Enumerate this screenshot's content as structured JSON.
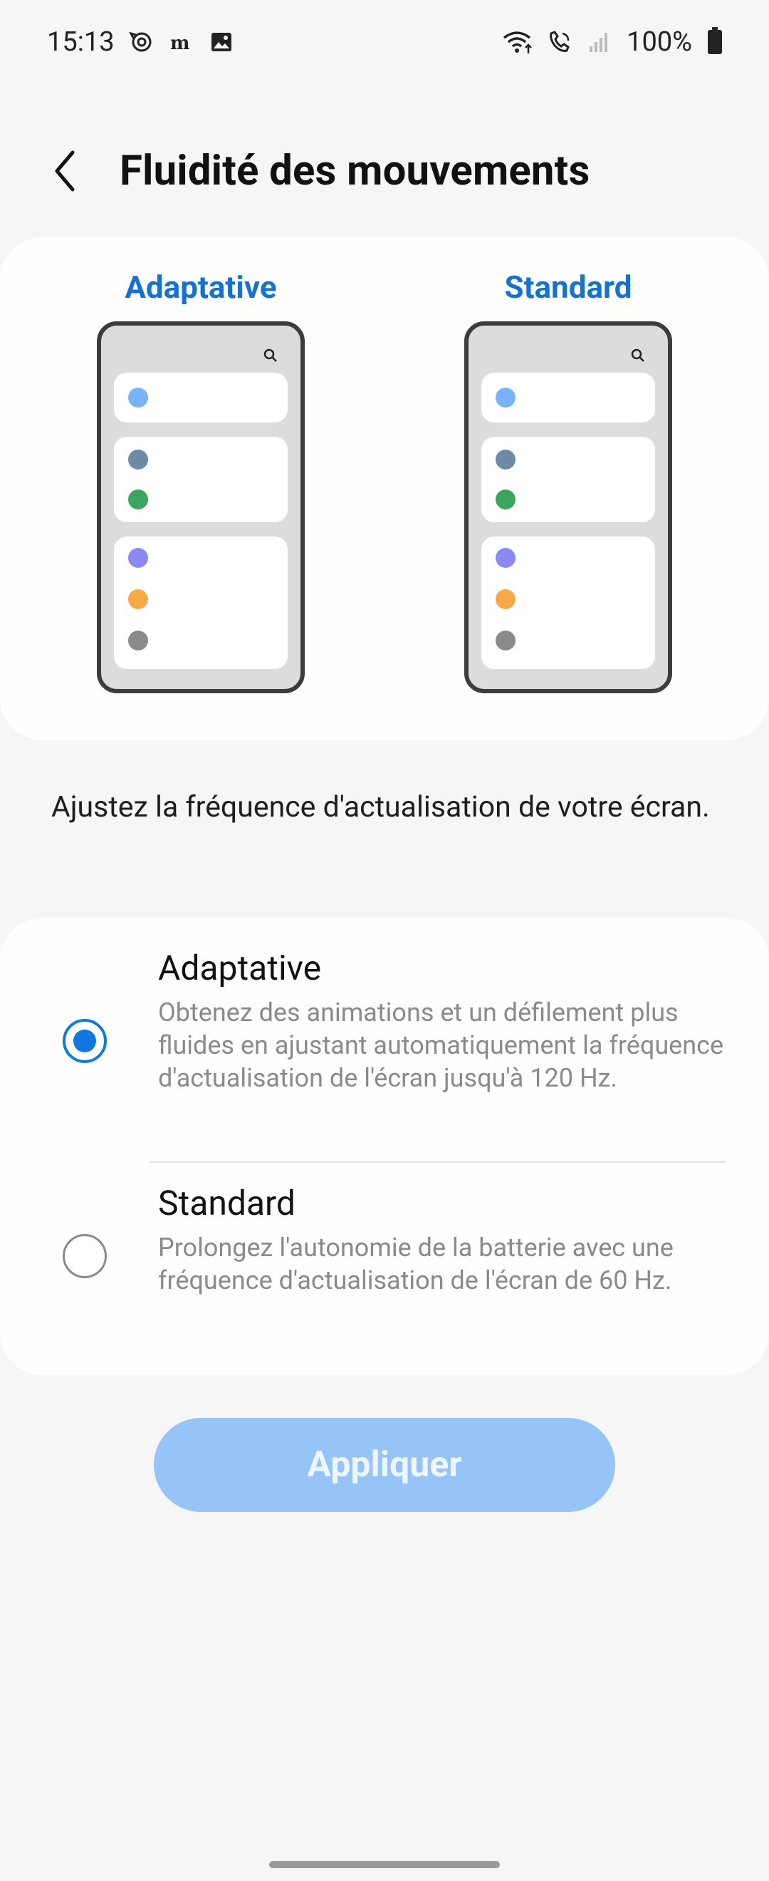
{
  "status_bar": {
    "time": "15:13",
    "battery_percent": "100%",
    "left_icons": [
      "sync-icon",
      "newspaper-icon",
      "image-icon"
    ],
    "right_icons": [
      "wifi-icon",
      "wifi-calling-icon",
      "signal-icon",
      "battery-icon"
    ]
  },
  "header": {
    "title": "Fluidité des mouvements",
    "back_icon": "chevron-left-icon"
  },
  "preview": {
    "adaptive_label": "Adaptative",
    "standard_label": "Standard",
    "accent_color": "#1473cf"
  },
  "description": "Ajustez la fréquence d'actualisation de votre écran.",
  "options": [
    {
      "title": "Adaptative",
      "description": "Obtenez des animations et un défilement plus fluides en ajustant automatiquement la fréquence d'actualisation de l'écran jusqu'à 120 Hz.",
      "selected": true
    },
    {
      "title": "Standard",
      "description": "Prolongez l'autonomie de la batterie avec une fréquence d'actualisation de l'écran de 60 Hz.",
      "selected": false
    }
  ],
  "apply_button": {
    "label": "Appliquer",
    "enabled": false,
    "color": "#96c4f6"
  }
}
